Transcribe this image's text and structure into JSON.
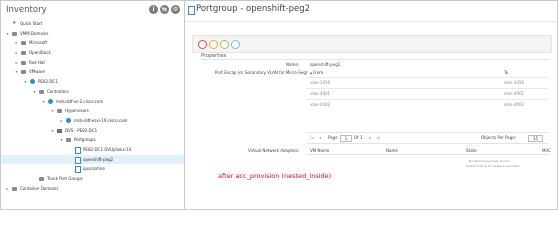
{
  "inventory": {
    "title": "Inventory",
    "header_icons": [
      "info-icon",
      "sync-icon",
      "gear-icon"
    ],
    "tree": [
      {
        "label": "Quick Start",
        "icon": "star",
        "level": 0,
        "caret": ""
      },
      {
        "label": "VMM Domains",
        "icon": "folder",
        "level": 0,
        "caret": "▾"
      },
      {
        "label": "Microsoft",
        "icon": "folder",
        "level": 1,
        "caret": "▸"
      },
      {
        "label": "OpenStack",
        "icon": "folder",
        "level": 1,
        "caret": "▸"
      },
      {
        "label": "Red Hat",
        "icon": "folder",
        "level": 1,
        "caret": "▸"
      },
      {
        "label": "VMware",
        "icon": "folder",
        "level": 1,
        "caret": "▾"
      },
      {
        "label": "PE82-DC1",
        "icon": "blue",
        "level": 2,
        "caret": "▾"
      },
      {
        "label": "Controllers",
        "icon": "folder",
        "level": 3,
        "caret": "▾"
      },
      {
        "label": "mslu-btf-vc-2.cisco.com",
        "icon": "blue",
        "level": 4,
        "caret": "▾"
      },
      {
        "label": "Hypervisors",
        "icon": "folder",
        "level": 5,
        "caret": "▾"
      },
      {
        "label": "mslu-btf-esxi-19.cisco.com",
        "icon": "blue",
        "level": 6,
        "caret": "▸"
      },
      {
        "label": "DVS - PE82-DC1",
        "icon": "grey",
        "level": 5,
        "caret": "▾"
      },
      {
        "label": "Portgroups",
        "icon": "folder",
        "level": 6,
        "caret": "▾"
      },
      {
        "label": "PE82-DC1-DVUplinks-14",
        "icon": "page",
        "level": 7,
        "caret": ""
      },
      {
        "label": "openshift-peg2",
        "icon": "page",
        "level": 7,
        "caret": "",
        "selected": true
      },
      {
        "label": "quarantine",
        "icon": "page",
        "level": 7,
        "caret": ""
      },
      {
        "label": "Trunk Port Groups",
        "icon": "folder",
        "level": 3,
        "caret": ""
      },
      {
        "label": "Container Domains",
        "icon": "folder",
        "level": 0,
        "caret": "▸"
      }
    ]
  },
  "content": {
    "title": "Portgroup - openshift-peg2",
    "properties_title": "Properties",
    "name_label": "Name:",
    "name_value": "openshift-peg2",
    "port_encap_label": "Port Encap (or Secondary VLAN for Micro-Seg):",
    "port_encap_header": {
      "from": "▴ From",
      "to": "To"
    },
    "port_encap_rows": [
      {
        "from": "vlan-3456",
        "to": "vlan-3456"
      },
      {
        "from": "vlan-4001",
        "to": "vlan-4001"
      },
      {
        "from": "vlan-4002",
        "to": "vlan-4002"
      }
    ],
    "pager": {
      "page_label": "Page",
      "page_value": "1",
      "of_label": "Of 1",
      "objects_label": "Objects Per Page:",
      "objects_value": "15"
    },
    "vna_label": "Virtual Network Adapters:",
    "vna_columns": [
      "VM Name",
      "Name",
      "State",
      "MAC"
    ],
    "vna_empty": [
      "No items have been found.",
      "Select Actions to create a new item."
    ],
    "annotation": "after acc_provision (nested_inside)"
  },
  "colors": {
    "accent": "#2a8fd8",
    "annotation": "#d01010",
    "selection": "#e1f1fb",
    "toolbar_dots": [
      "#e44b4b",
      "#f0a43a",
      "#9bc94a",
      "#7cbdeb"
    ]
  }
}
